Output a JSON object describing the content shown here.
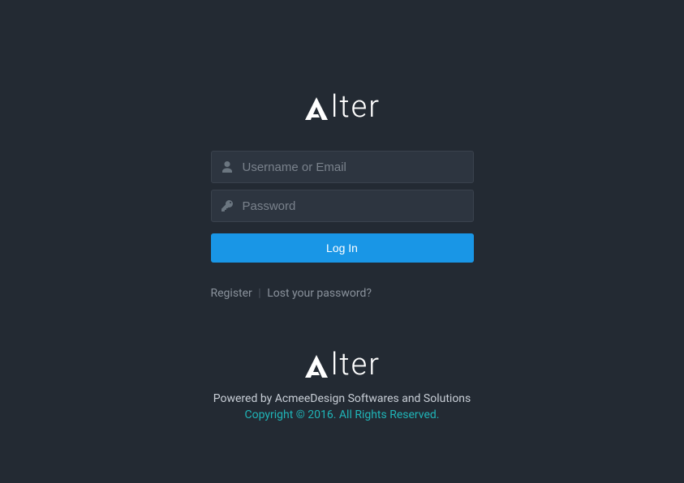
{
  "brand": {
    "name": "Alter"
  },
  "form": {
    "username_placeholder": "Username or Email",
    "password_placeholder": "Password",
    "login_label": "Log In"
  },
  "links": {
    "register": "Register",
    "separator": "|",
    "lost_password": "Lost your password?"
  },
  "footer": {
    "powered": "Powered by AcmeeDesign Softwares and Solutions",
    "copyright": "Copyright © 2016. All Rights Reserved."
  }
}
